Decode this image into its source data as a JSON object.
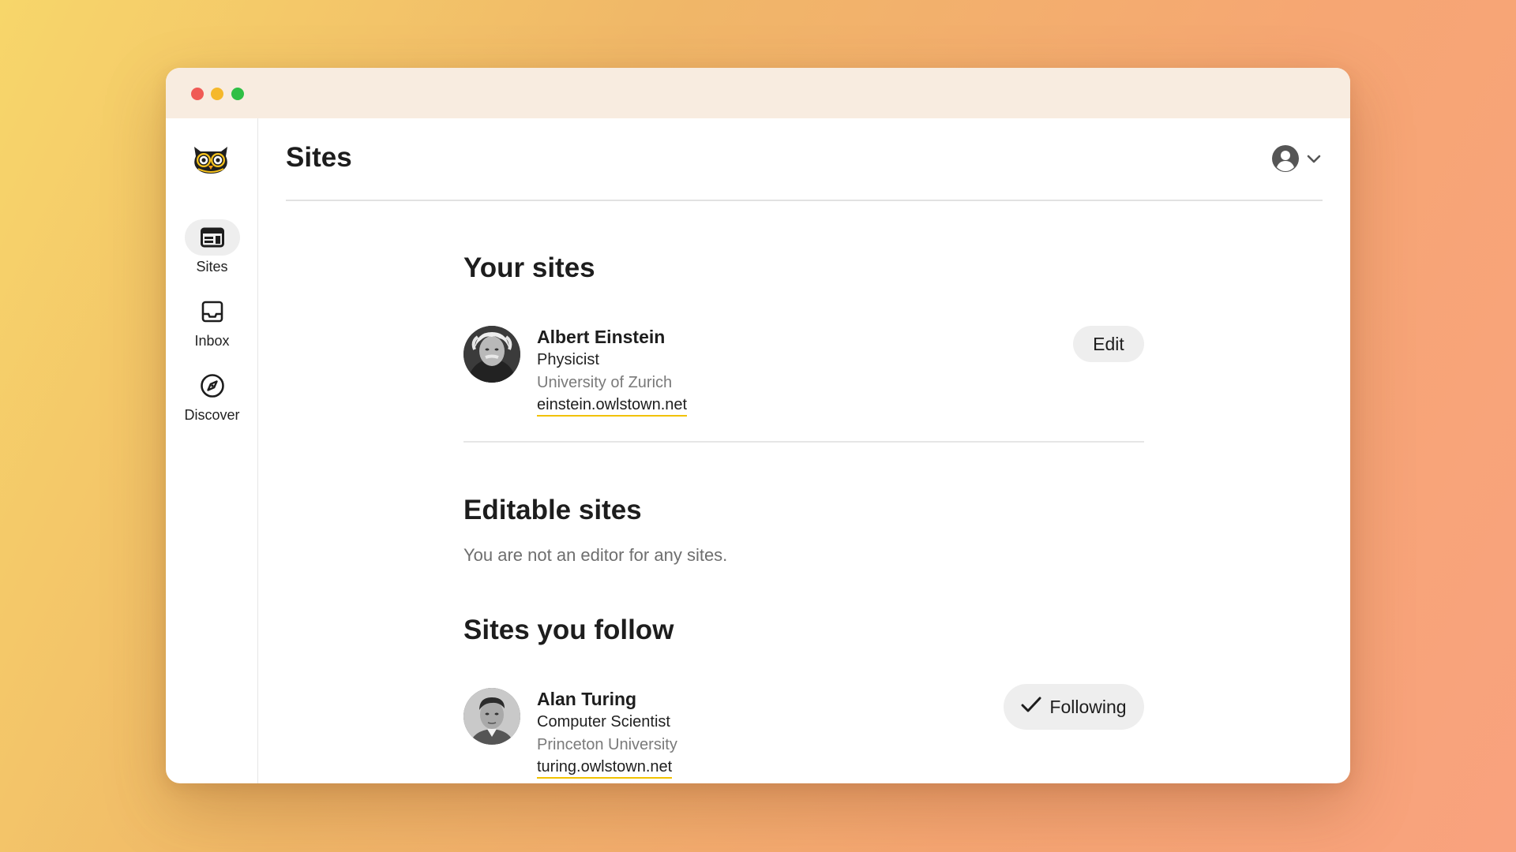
{
  "page": {
    "title": "Sites"
  },
  "sidebar": {
    "items": [
      {
        "label": "Sites",
        "icon": "sites-icon",
        "active": true
      },
      {
        "label": "Inbox",
        "icon": "inbox-icon",
        "active": false
      },
      {
        "label": "Discover",
        "icon": "compass-icon",
        "active": false
      }
    ]
  },
  "account": {
    "icon": "user-circle-icon",
    "menu_icon": "chevron-down-icon"
  },
  "your_sites": {
    "heading": "Your sites",
    "sites": [
      {
        "name": "Albert Einstein",
        "role": "Physicist",
        "org": "University of Zurich",
        "url": "einstein.owlstown.net",
        "action": "Edit"
      }
    ]
  },
  "editable_sites": {
    "heading": "Editable sites",
    "empty_message": "You are not an editor for any sites."
  },
  "followed_sites": {
    "heading": "Sites you follow",
    "sites": [
      {
        "name": "Alan Turing",
        "role": "Computer Scientist",
        "org": "Princeton University",
        "url": "turing.owlstown.net",
        "action": "Following"
      }
    ]
  },
  "colors": {
    "link_underline": "#f2c200",
    "button_bg": "#eeeeee",
    "titlebar": "#f8ece0"
  }
}
